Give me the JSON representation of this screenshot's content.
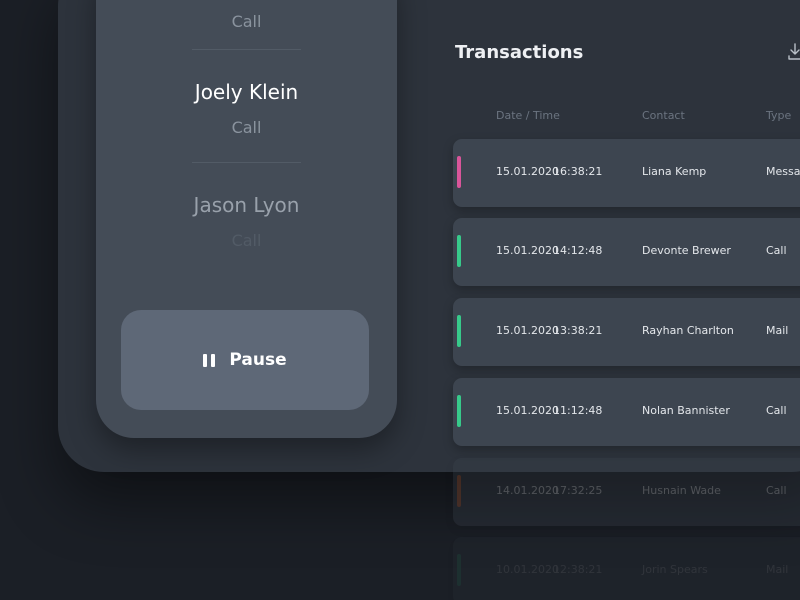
{
  "phone": {
    "contacts": [
      {
        "name": "",
        "kind": "Call"
      },
      {
        "name": "Joely Klein",
        "kind": "Call"
      },
      {
        "name": "Jason Lyon",
        "kind": "Call"
      }
    ],
    "pause_label": "Pause"
  },
  "transactions": {
    "title": "Transactions",
    "columns": [
      "Date / Time",
      "Contact",
      "Type"
    ],
    "rows": [
      {
        "date": "15.01.2020",
        "time": "16:38:21",
        "contact": "Liana Kemp",
        "type": "Message",
        "status_color": "#d9559a"
      },
      {
        "date": "15.01.2020",
        "time": "14:12:48",
        "contact": "Devonte Brewer",
        "type": "Call",
        "status_color": "#37c98a"
      },
      {
        "date": "15.01.2020",
        "time": "13:38:21",
        "contact": "Rayhan Charlton",
        "type": "Mail",
        "status_color": "#37c98a"
      },
      {
        "date": "15.01.2020",
        "time": "11:12:48",
        "contact": "Nolan Bannister",
        "type": "Call",
        "status_color": "#37c98a"
      },
      {
        "date": "14.01.2020",
        "time": "17:32:25",
        "contact": "Husnain Wade",
        "type": "Call",
        "status_color": "#c0653b"
      },
      {
        "date": "10.01.2020",
        "time": "12:38:21",
        "contact": "Jorin Spears",
        "type": "Mail",
        "status_color": "#37c98a"
      }
    ]
  }
}
